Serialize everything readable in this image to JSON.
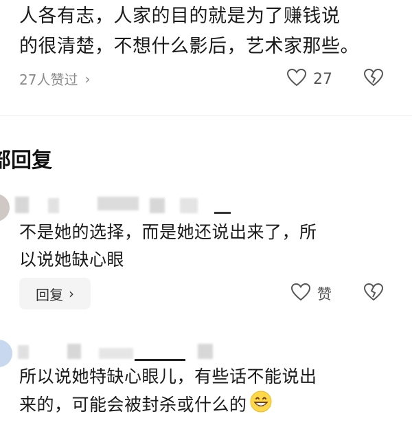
{
  "top_comment": {
    "text_line1": "人各有志，人家的目的就是为了赚钱说",
    "text_line2": "的很清楚，不想什么影后，艺术家那些。",
    "likers_text": "27人赞过",
    "likers_chevron": "›",
    "like_count": "27",
    "like_icon": "heart-outline-icon",
    "dislike_icon": "broken-heart-outline-icon"
  },
  "section": {
    "title": "部回复"
  },
  "replies": [
    {
      "text_line1": "不是她的选择，而是她还说出来了，所",
      "text_line2": "以说她缺心眼",
      "reply_label": "回复",
      "reply_chevron": "›",
      "like_label": "赞",
      "like_icon": "heart-outline-icon",
      "dislike_icon": "broken-heart-outline-icon"
    },
    {
      "text_line1": "所以说她特缺心眼儿，有些话不能说出",
      "text_line2": "来的，可能会被封杀或什么的",
      "emoji": "grinning-face-emoji"
    }
  ],
  "colors": {
    "text": "#1a1a1a",
    "muted": "#8a8a8a",
    "divider": "#ececec",
    "button_bg": "#f4f4f4"
  }
}
